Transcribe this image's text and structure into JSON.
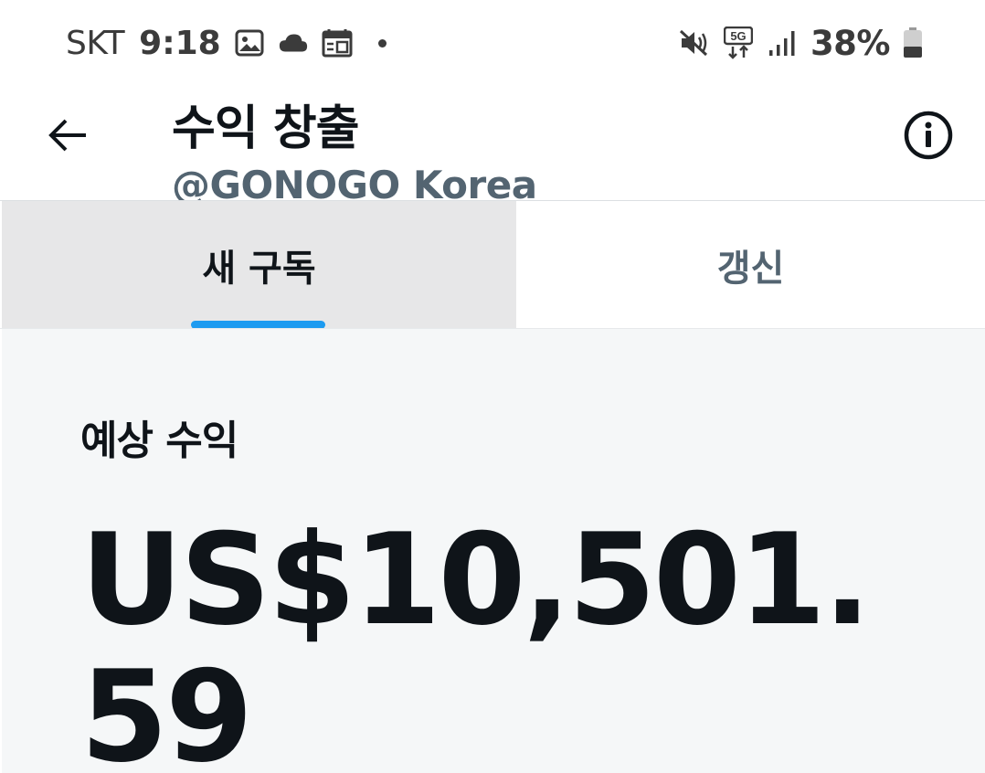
{
  "status_bar": {
    "carrier": "SKT",
    "time": "9:18",
    "left_icons": [
      "image-icon",
      "cloud-icon",
      "calendar-icon",
      "notification-dot-icon"
    ],
    "right_icons": [
      "mute-icon",
      "5g-icon",
      "signal-icon",
      "battery-icon"
    ],
    "network": "5G",
    "battery": "38%"
  },
  "header": {
    "title": "수익 창출",
    "subtitle": "@GONOGO Korea",
    "back_icon": "arrow-left-icon",
    "info_icon": "info-icon"
  },
  "tabs": [
    {
      "label": "새 구독",
      "selected": true
    },
    {
      "label": "갱신",
      "selected": false
    }
  ],
  "earnings": {
    "label": "예상 수익",
    "value": "US$10,501.59"
  },
  "colors": {
    "accent": "#1d9bf0",
    "text_primary": "#0f1419",
    "text_secondary": "#536471",
    "content_bg": "#f5f7f8",
    "active_tab_bg": "#e7e7e8"
  }
}
